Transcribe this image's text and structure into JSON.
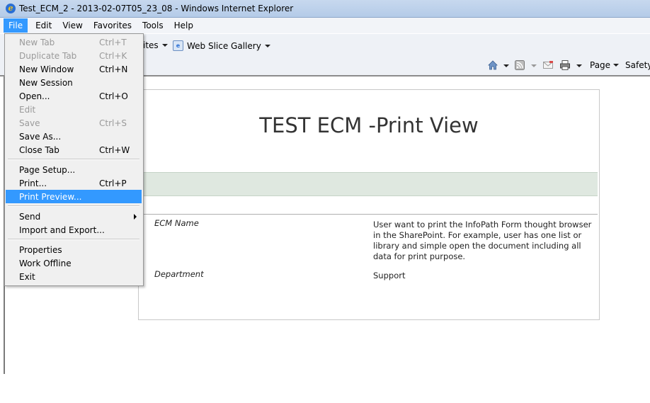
{
  "window": {
    "title": "Test_ECM_2 - 2013-02-07T05_23_08 - Windows Internet Explorer"
  },
  "menubar": [
    "File",
    "Edit",
    "View",
    "Favorites",
    "Tools",
    "Help"
  ],
  "favorites_bar": {
    "partial_label": "ites",
    "web_slice_label": "Web Slice Gallery"
  },
  "command_bar": {
    "page_label": "Page",
    "safety_label": "Safety"
  },
  "file_menu": {
    "items": [
      {
        "label": "New Tab",
        "shortcut": "Ctrl+T",
        "enabled": false
      },
      {
        "label": "Duplicate Tab",
        "shortcut": "Ctrl+K",
        "enabled": false
      },
      {
        "label": "New Window",
        "shortcut": "Ctrl+N",
        "enabled": true
      },
      {
        "label": "New Session",
        "shortcut": "",
        "enabled": true
      },
      {
        "label": "Open...",
        "shortcut": "Ctrl+O",
        "enabled": true
      },
      {
        "label": "Edit",
        "shortcut": "",
        "enabled": false
      },
      {
        "label": "Save",
        "shortcut": "Ctrl+S",
        "enabled": false
      },
      {
        "label": "Save As...",
        "shortcut": "",
        "enabled": true
      },
      {
        "label": "Close Tab",
        "shortcut": "Ctrl+W",
        "enabled": true
      },
      {
        "label": "Page Setup...",
        "shortcut": "",
        "enabled": true
      },
      {
        "label": "Print...",
        "shortcut": "Ctrl+P",
        "enabled": true
      },
      {
        "label": "Print Preview...",
        "shortcut": "",
        "enabled": true,
        "highlighted": true
      },
      {
        "label": "Send",
        "shortcut": "",
        "enabled": true,
        "submenu": true
      },
      {
        "label": "Import and Export...",
        "shortcut": "",
        "enabled": true
      },
      {
        "label": "Properties",
        "shortcut": "",
        "enabled": true
      },
      {
        "label": "Work Offline",
        "shortcut": "",
        "enabled": true
      },
      {
        "label": "Exit",
        "shortcut": "",
        "enabled": true
      }
    ]
  },
  "document": {
    "title": "TEST ECM -Print View",
    "fields": [
      {
        "label": "ECM Name",
        "value_lines": [
          "User want to print the InfoPath Form thought browser",
          "in the SharePoint. For example, user has one list or",
          "library and simple open the document including all",
          "data for print purpose."
        ]
      },
      {
        "label": "Department",
        "value_lines": [
          "Support"
        ]
      }
    ]
  },
  "colors": {
    "highlight": "#3399ff",
    "band": "#dfe8e0"
  }
}
